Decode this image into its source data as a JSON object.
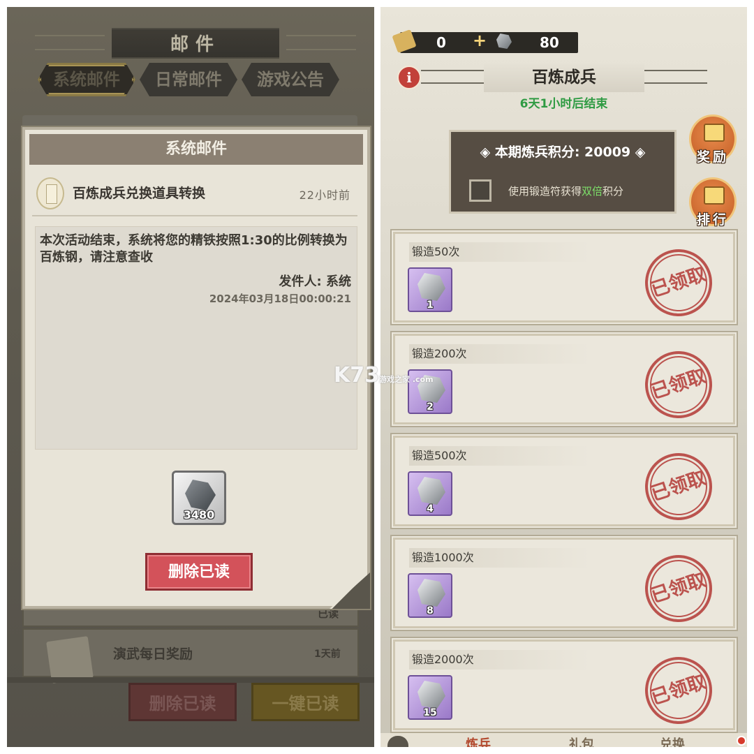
{
  "left": {
    "window_title": "邮件",
    "tabs": [
      {
        "label": "系统邮件",
        "active": true
      },
      {
        "label": "日常邮件",
        "active": false
      },
      {
        "label": "游戏公告",
        "active": false
      }
    ],
    "modal": {
      "header": "系统邮件",
      "subject": "百炼成兵兑换道具转换",
      "time": "22小时前",
      "content": "本次活动结束，系统将您的精铁按照1:30的比例转换为百炼钢，请注意查收",
      "sender": "发件人: 系统",
      "date": "2024年03月18日00:00:21",
      "attachment_qty": "3480",
      "delete_label": "删除已读"
    },
    "background_list": [
      {
        "title": "",
        "status": "已读"
      },
      {
        "title": "演武每日奖励",
        "time": "1天前"
      }
    ],
    "bottom_buttons": {
      "delete_read": "删除已读",
      "read_all": "一键已读"
    }
  },
  "right": {
    "currency": {
      "scroll_value": "0",
      "plus": "+",
      "iron_value": "80"
    },
    "info_label": "i",
    "title": "百炼成兵",
    "countdown": "6天1小时后结束",
    "score_label": "◈ 本期炼兵积分: 20009 ◈",
    "double_text_prefix": "使用锻造符获得",
    "double_text_highlight": "双倍",
    "double_text_suffix": "积分",
    "side_buttons": {
      "reward": "奖励",
      "rank": "排行"
    },
    "milestones": [
      {
        "label": "锻造50次",
        "qty": "1",
        "stamp": "已领取"
      },
      {
        "label": "锻造200次",
        "qty": "2",
        "stamp": "已领取"
      },
      {
        "label": "锻造500次",
        "qty": "4",
        "stamp": "已领取"
      },
      {
        "label": "锻造1000次",
        "qty": "8",
        "stamp": "已领取"
      },
      {
        "label": "锻造2000次",
        "qty": "15",
        "stamp": "已领取"
      }
    ],
    "bottom_tabs": [
      "炼兵",
      "礼包",
      "兑换"
    ]
  },
  "watermark": {
    "main": "K73",
    "sub": "游戏之家 .com"
  },
  "colors": {
    "accent_green": "#2f9b43",
    "stamp_red": "#b33a36",
    "delete_red": "#d3525a"
  }
}
